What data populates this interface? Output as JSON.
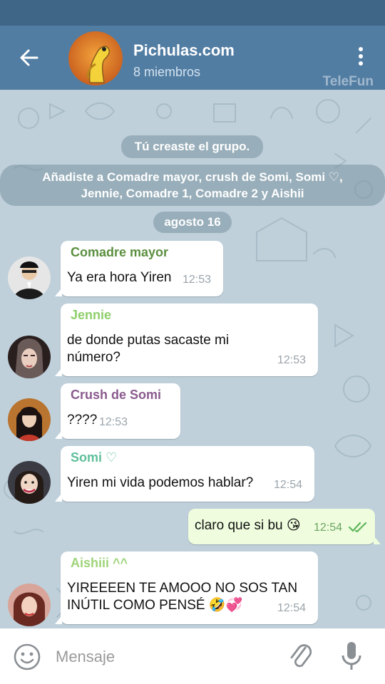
{
  "header": {
    "title": "Pichulas.com",
    "subtitle": "8 miembros",
    "watermark": "TeleFun"
  },
  "service_messages": [
    "Tú creaste el grupo.",
    "Añadiste a Comadre mayor, crush de Somi, Somi ♡,",
    "Jennie, Comadre 1, Comadre 2 y Aishii",
    "agosto 16"
  ],
  "messages": [
    {
      "sender": "Comadre mayor",
      "sender_color": "#5b8f3f",
      "lines": [
        "Ya era hora Yiren"
      ],
      "time": "12:53"
    },
    {
      "sender": "Jennie",
      "sender_color": "#8fcf6b",
      "lines": [
        "de donde putas sacaste mi",
        "número?"
      ],
      "time": "12:53"
    },
    {
      "sender": "Crush de Somi",
      "sender_color": "#8a5a8e",
      "lines": [
        "????"
      ],
      "time": "12:53"
    },
    {
      "sender": "Somi ♡",
      "sender_color": "#5fbf9c",
      "lines": [
        "Yiren mi vida podemos hablar?"
      ],
      "time": "12:54"
    },
    {
      "sender": "",
      "lines": [
        "claro que si bu 😘"
      ],
      "time": "12:54",
      "outgoing": true,
      "status": "read"
    },
    {
      "sender": "Aishiii ^^",
      "sender_color": "#9fd47a",
      "lines": [
        "YIREEEEN TE AMOOO NO SOS TAN",
        "INÚTIL COMO PENSÉ 🤣💞"
      ],
      "time": "12:54"
    }
  ],
  "composer": {
    "placeholder": "Mensaje"
  },
  "icons": {
    "back": "arrow-left-icon",
    "menu": "more-vertical-icon",
    "emoji": "smiley-icon",
    "attach": "paperclip-icon",
    "mic": "microphone-icon",
    "read": "double-check-icon"
  },
  "colors": {
    "toolbar": "#527da3",
    "status_bar": "#3f6687",
    "outgoing_bubble": "#effdde",
    "read_check": "#5fb45a"
  }
}
